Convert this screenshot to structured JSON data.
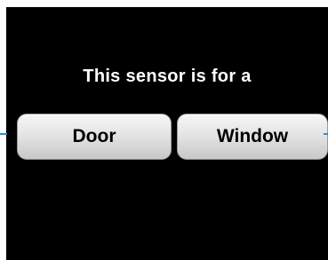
{
  "prompt": {
    "text": "This sensor is for a"
  },
  "choices": [
    {
      "label": "Door"
    },
    {
      "label": "Window"
    }
  ],
  "colors": {
    "background": "#000000",
    "prompt_text": "#ffffff",
    "button_text": "#000000",
    "button_fill": "#e4e4e4",
    "indicator": "#2a8fd0"
  }
}
